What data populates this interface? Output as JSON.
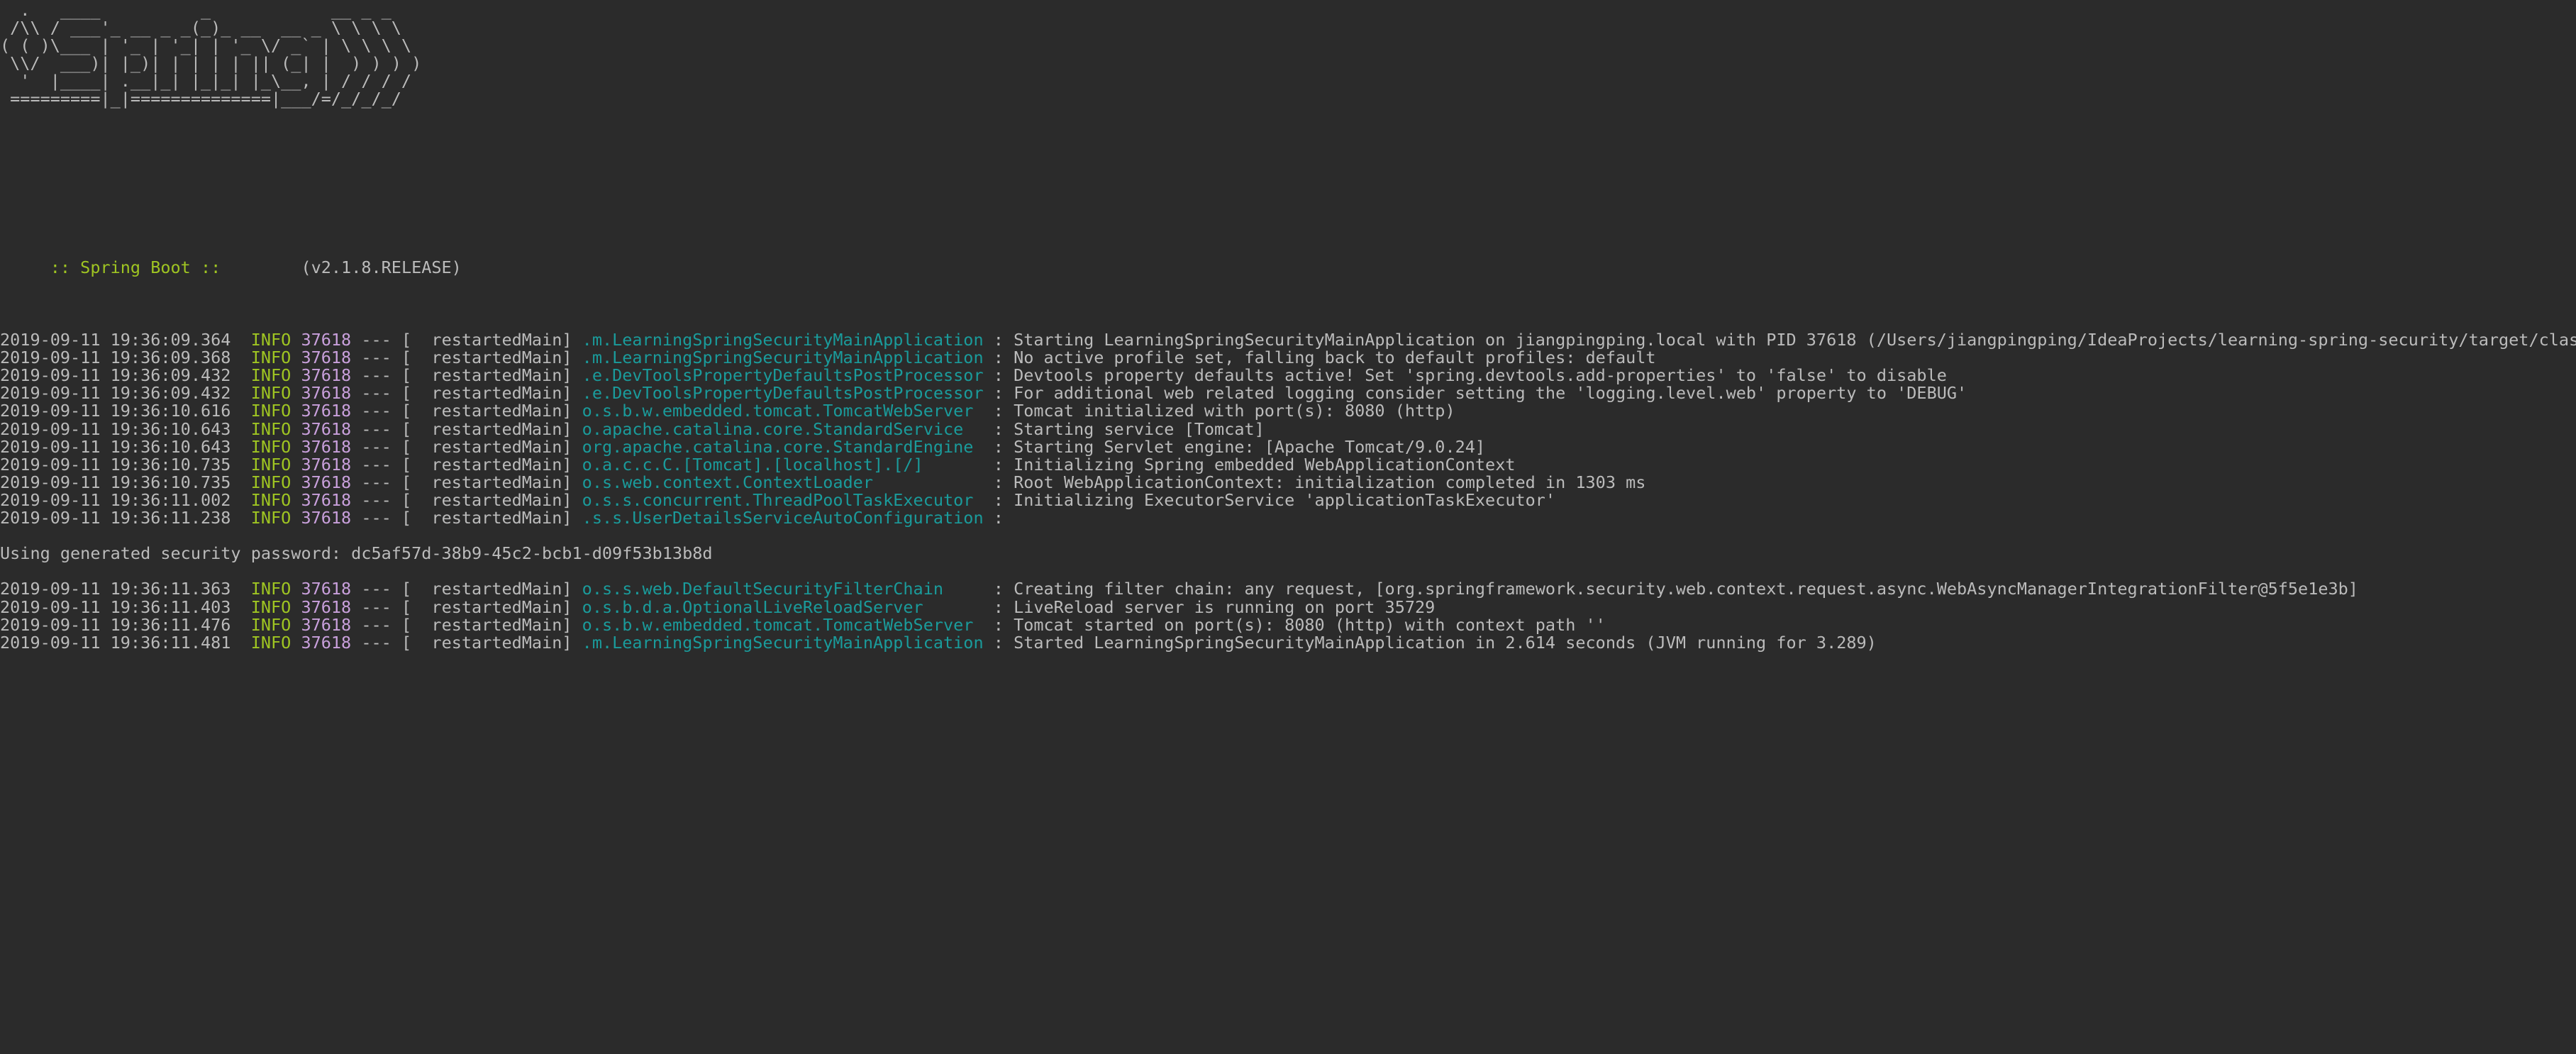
{
  "console": {
    "background_color": "#2b2b2b",
    "default_text_color": "#bbbbbb",
    "level_color": "#9fc522",
    "pid_color": "#c9a0dc",
    "logger_color": "#1a9b9b"
  },
  "banner": {
    "lines": [
      "  .   ____          _            __ _ _",
      " /\\\\ / ___'_ __ _ _(_)_ __  __ _ \\ \\ \\ \\",
      "( ( )\\___ | '_ | '_| | '_ \\/ _` | \\ \\ \\ \\",
      " \\\\/  ___)| |_)| | | | | || (_| |  ) ) ) )",
      "  '  |____| .__|_| |_|_| |_\\__, | / / / /",
      " =========|_|==============|___/=/_/_/_/"
    ],
    "footer_label": " :: Spring Boot :: ",
    "footer_version": "       (v2.1.8.RELEASE)"
  },
  "log": {
    "lines": [
      {
        "type": "blank"
      },
      {
        "type": "entry",
        "timestamp": "2019-09-11 19:36:09.364",
        "level": "INFO",
        "pid": "37618",
        "dashes": "---",
        "thread": "[  restartedMain]",
        "logger": ".m.LearningSpringSecurityMainApplication",
        "separator": ":",
        "message": "Starting LearningSpringSecurityMainApplication on jiangpingping.local with PID 37618 (/Users/jiangpingping/IdeaProjects/learning-spring-security/target/classes started by jiangpingping in /Users/jiangpingping/IdeaProjects/learning-spring-security)"
      },
      {
        "type": "entry",
        "timestamp": "2019-09-11 19:36:09.368",
        "level": "INFO",
        "pid": "37618",
        "dashes": "---",
        "thread": "[  restartedMain]",
        "logger": ".m.LearningSpringSecurityMainApplication",
        "separator": ":",
        "message": "No active profile set, falling back to default profiles: default"
      },
      {
        "type": "entry",
        "timestamp": "2019-09-11 19:36:09.432",
        "level": "INFO",
        "pid": "37618",
        "dashes": "---",
        "thread": "[  restartedMain]",
        "logger": ".e.DevToolsPropertyDefaultsPostProcessor",
        "separator": ":",
        "message": "Devtools property defaults active! Set 'spring.devtools.add-properties' to 'false' to disable"
      },
      {
        "type": "entry",
        "timestamp": "2019-09-11 19:36:09.432",
        "level": "INFO",
        "pid": "37618",
        "dashes": "---",
        "thread": "[  restartedMain]",
        "logger": ".e.DevToolsPropertyDefaultsPostProcessor",
        "separator": ":",
        "message": "For additional web related logging consider setting the 'logging.level.web' property to 'DEBUG'"
      },
      {
        "type": "entry",
        "timestamp": "2019-09-11 19:36:10.616",
        "level": "INFO",
        "pid": "37618",
        "dashes": "---",
        "thread": "[  restartedMain]",
        "logger": "o.s.b.w.embedded.tomcat.TomcatWebServer",
        "separator": ":",
        "message": "Tomcat initialized with port(s): 8080 (http)"
      },
      {
        "type": "entry",
        "timestamp": "2019-09-11 19:36:10.643",
        "level": "INFO",
        "pid": "37618",
        "dashes": "---",
        "thread": "[  restartedMain]",
        "logger": "o.apache.catalina.core.StandardService",
        "separator": ":",
        "message": "Starting service [Tomcat]"
      },
      {
        "type": "entry",
        "timestamp": "2019-09-11 19:36:10.643",
        "level": "INFO",
        "pid": "37618",
        "dashes": "---",
        "thread": "[  restartedMain]",
        "logger": "org.apache.catalina.core.StandardEngine",
        "separator": ":",
        "message": "Starting Servlet engine: [Apache Tomcat/9.0.24]"
      },
      {
        "type": "entry",
        "timestamp": "2019-09-11 19:36:10.735",
        "level": "INFO",
        "pid": "37618",
        "dashes": "---",
        "thread": "[  restartedMain]",
        "logger": "o.a.c.c.C.[Tomcat].[localhost].[/]",
        "separator": ":",
        "message": "Initializing Spring embedded WebApplicationContext"
      },
      {
        "type": "entry",
        "timestamp": "2019-09-11 19:36:10.735",
        "level": "INFO",
        "pid": "37618",
        "dashes": "---",
        "thread": "[  restartedMain]",
        "logger": "o.s.web.context.ContextLoader",
        "separator": ":",
        "message": "Root WebApplicationContext: initialization completed in 1303 ms"
      },
      {
        "type": "entry",
        "timestamp": "2019-09-11 19:36:11.002",
        "level": "INFO",
        "pid": "37618",
        "dashes": "---",
        "thread": "[  restartedMain]",
        "logger": "o.s.s.concurrent.ThreadPoolTaskExecutor",
        "separator": ":",
        "message": "Initializing ExecutorService 'applicationTaskExecutor'"
      },
      {
        "type": "entry",
        "timestamp": "2019-09-11 19:36:11.238",
        "level": "INFO",
        "pid": "37618",
        "dashes": "---",
        "thread": "[  restartedMain]",
        "logger": ".s.s.UserDetailsServiceAutoConfiguration",
        "separator": ":",
        "message": ""
      },
      {
        "type": "blank"
      },
      {
        "type": "plain",
        "text": "Using generated security password: dc5af57d-38b9-45c2-bcb1-d09f53b13b8d"
      },
      {
        "type": "blank"
      },
      {
        "type": "entry",
        "timestamp": "2019-09-11 19:36:11.363",
        "level": "INFO",
        "pid": "37618",
        "dashes": "---",
        "thread": "[  restartedMain]",
        "logger": "o.s.s.web.DefaultSecurityFilterChain",
        "separator": ":",
        "message": "Creating filter chain: any request, [org.springframework.security.web.context.request.async.WebAsyncManagerIntegrationFilter@5f5e1e3b]"
      },
      {
        "type": "entry",
        "timestamp": "2019-09-11 19:36:11.403",
        "level": "INFO",
        "pid": "37618",
        "dashes": "---",
        "thread": "[  restartedMain]",
        "logger": "o.s.b.d.a.OptionalLiveReloadServer",
        "separator": ":",
        "message": "LiveReload server is running on port 35729"
      },
      {
        "type": "entry",
        "timestamp": "2019-09-11 19:36:11.476",
        "level": "INFO",
        "pid": "37618",
        "dashes": "---",
        "thread": "[  restartedMain]",
        "logger": "o.s.b.w.embedded.tomcat.TomcatWebServer",
        "separator": ":",
        "message": "Tomcat started on port(s): 8080 (http) with context path ''"
      },
      {
        "type": "entry",
        "timestamp": "2019-09-11 19:36:11.481",
        "level": "INFO",
        "pid": "37618",
        "dashes": "---",
        "thread": "[  restartedMain]",
        "logger": ".m.LearningSpringSecurityMainApplication",
        "separator": ":",
        "message": "Started LearningSpringSecurityMainApplication in 2.614 seconds (JVM running for 3.289)"
      }
    ]
  }
}
